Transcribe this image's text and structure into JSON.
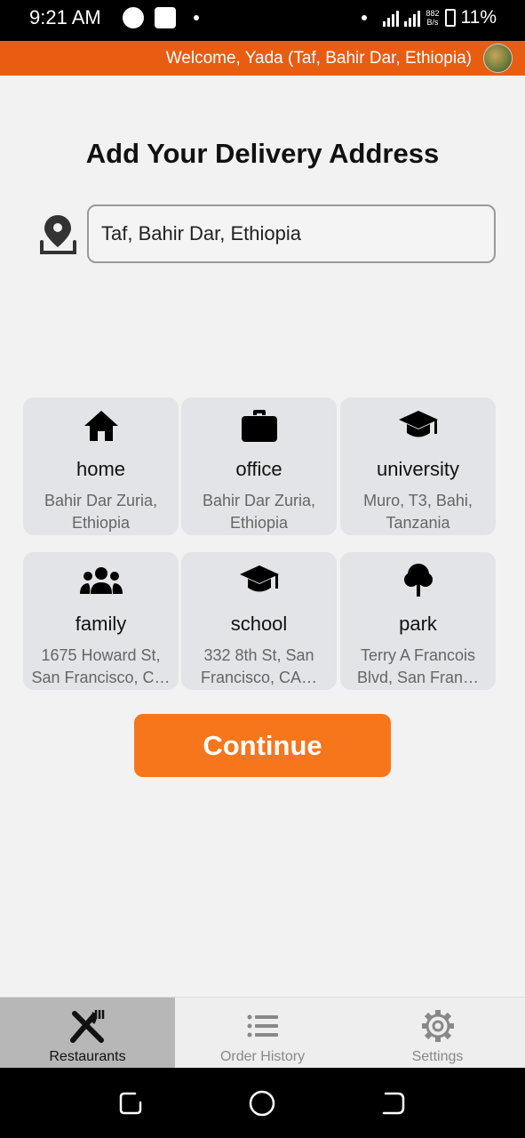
{
  "status_bar": {
    "time": "9:21 AM",
    "net_speed_value": "882",
    "net_speed_unit": "B/s",
    "battery": "11%"
  },
  "header": {
    "welcome_text": "Welcome, Yada (Taf, Bahir Dar, Ethiopia)",
    "avatar_icon": "user-avatar"
  },
  "main": {
    "title": "Add Your Delivery Address",
    "address_value": "Taf, Bahir Dar, Ethiopia",
    "location_icon": "map-pin-icon"
  },
  "saved_addresses": [
    {
      "label": "home",
      "address": "Bahir Dar Zuria,\nEthiopia",
      "icon": "home-icon"
    },
    {
      "label": "office",
      "address": "Bahir Dar Zuria,\nEthiopia",
      "icon": "briefcase-icon"
    },
    {
      "label": "university",
      "address": "Muro, T3, Bahi,\nTanzania",
      "icon": "graduation-cap-icon"
    },
    {
      "label": "family",
      "address": "1675 Howard St,\nSan Francisco, C…",
      "icon": "people-icon"
    },
    {
      "label": "school",
      "address": "332 8th St, San\nFrancisco, CA…",
      "icon": "graduation-cap-icon"
    },
    {
      "label": "park",
      "address": "Terry A Francois\nBlvd, San Fran…",
      "icon": "tree-icon"
    }
  ],
  "continue_label": "Continue",
  "bottom_nav": {
    "items": [
      {
        "label": "Restaurants",
        "icon": "fork-knife-icon",
        "active": true
      },
      {
        "label": "Order History",
        "icon": "list-icon",
        "active": false
      },
      {
        "label": "Settings",
        "icon": "gear-icon",
        "active": false
      }
    ]
  },
  "colors": {
    "header_bg": "#e85d12",
    "accent": "#f7761b",
    "card_bg": "#e3e4e8",
    "active_tab_bg": "#b7b7b7"
  }
}
